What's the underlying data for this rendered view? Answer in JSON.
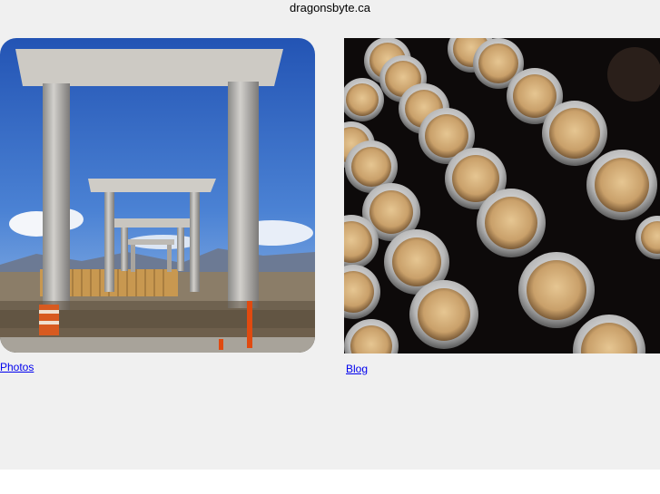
{
  "site": {
    "title": "dragonsbyte.ca"
  },
  "tiles": [
    {
      "label": "Photos",
      "image": "concrete-gateway-photo"
    },
    {
      "label": "Blog",
      "image": "typewriter-keys-photo"
    }
  ],
  "colors": {
    "background": "#f0f0f0",
    "link": "#0000ee",
    "sky": "#3d6fc8"
  }
}
